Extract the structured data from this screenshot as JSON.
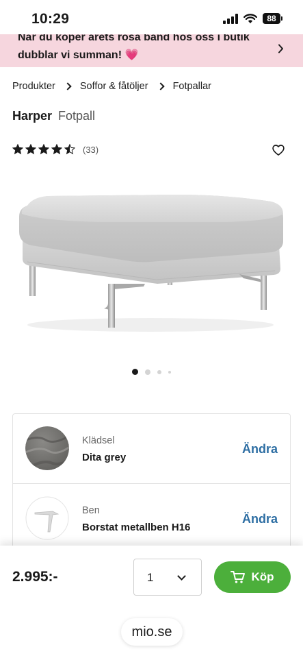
{
  "status": {
    "time": "10:29",
    "battery": "88"
  },
  "promo": {
    "text": "När du köper årets rosa band hos oss i butik dubblar vi summan! 💗"
  },
  "breadcrumb": {
    "items": [
      "Produkter",
      "Soffor & fåtöljer",
      "Fotpallar"
    ]
  },
  "product": {
    "name": "Harper",
    "type": "Fotpall",
    "rating": 4.5,
    "review_count": "(33)"
  },
  "carousel": {
    "image_count": 4,
    "active_index": 0
  },
  "options": [
    {
      "label": "Klädsel",
      "value": "Dita grey",
      "action": "Ändra"
    },
    {
      "label": "Ben",
      "value": "Borstat metallben H16",
      "action": "Ändra"
    }
  ],
  "purchase": {
    "price": "2.995:-",
    "quantity": "1",
    "buy_label": "Köp"
  },
  "browser": {
    "url": "mio.se"
  },
  "colors": {
    "promo_bg": "#f6d6de",
    "link": "#2d6ea3",
    "buy_button": "#4caf3b"
  }
}
